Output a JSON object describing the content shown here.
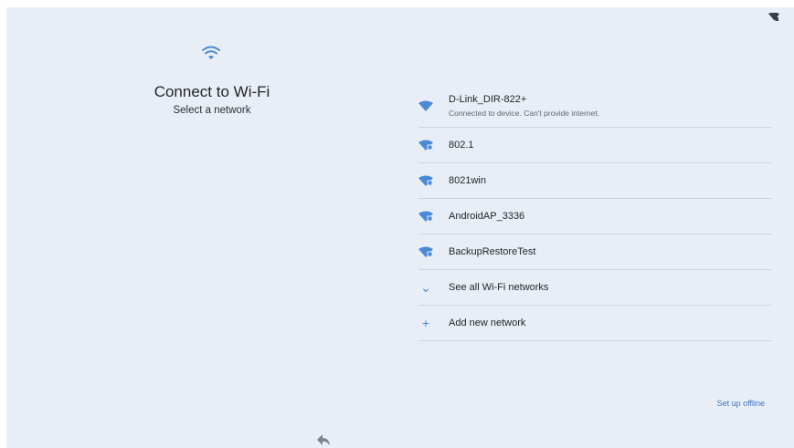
{
  "header": {
    "title": "Connect to Wi-Fi",
    "subtitle": "Select a network"
  },
  "networks": [
    {
      "name": "D-Link_DIR-822+",
      "status": "Connected to device. Can't provide internet.",
      "icon": "wifi-icon"
    },
    {
      "name": "802.1",
      "icon": "wifi-lock-icon"
    },
    {
      "name": "8021win",
      "icon": "wifi-lock-icon"
    },
    {
      "name": "AndroidAP_3336",
      "icon": "wifi-lock-icon"
    },
    {
      "name": "BackupRestoreTest",
      "icon": "wifi-lock-icon"
    }
  ],
  "actions": {
    "see_all": "See all Wi-Fi networks",
    "add_new": "Add new network",
    "offline": "Set up offline"
  },
  "colors": {
    "accent": "#4a8ad6",
    "background": "#e9eef6"
  }
}
